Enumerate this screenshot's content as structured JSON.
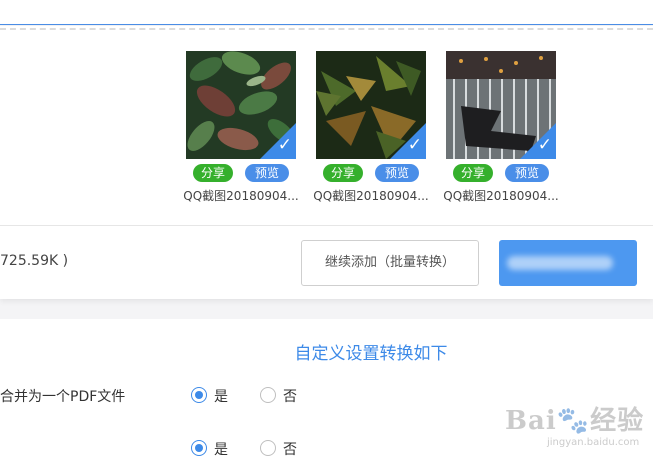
{
  "upload": {
    "images": [
      {
        "filename": "QQ截图20180904...",
        "share_label": "分享",
        "preview_label": "预览",
        "selected": true
      },
      {
        "filename": "QQ截图20180904...",
        "share_label": "分享",
        "preview_label": "预览",
        "selected": true
      },
      {
        "filename": "QQ截图20180904...",
        "share_label": "分享",
        "preview_label": "预览",
        "selected": true
      }
    ],
    "size_text": "725.59K )",
    "continue_button": "继续添加（批量转换）",
    "check_icon": "checkmark-icon"
  },
  "settings": {
    "title": "自定义设置转换如下",
    "rows": [
      {
        "label": "合并为一个PDF文件",
        "yes_label": "是",
        "no_label": "否",
        "selected": "yes"
      },
      {
        "label": "",
        "yes_label": "是",
        "no_label": "否",
        "selected": "yes"
      }
    ]
  },
  "watermark": {
    "main": "Bai🐾经验",
    "sub": "jingyan.baidu.com"
  },
  "colors": {
    "accent": "#3d8ae8",
    "share": "#35b02c",
    "preview": "#4a8ee8"
  }
}
